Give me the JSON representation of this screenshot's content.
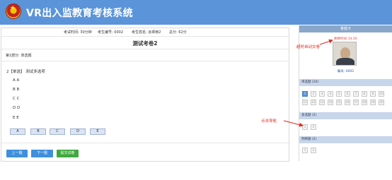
{
  "header": {
    "title": "VR出入监教育考核系统"
  },
  "info": {
    "exam_time": "考试时间: 30分钟",
    "examinee_no": "考生编号: 0002",
    "examinee_name": "考生姓名: 谷翠雨2",
    "score": "总分: 62分"
  },
  "exam": {
    "title": "测试考卷2",
    "part": "第1部分: 单选题",
    "question": "2【单选】 测试多选项",
    "options": [
      "A A",
      "B B",
      "C C",
      "D D",
      "E E"
    ],
    "answer_buttons": [
      "A",
      "B",
      "C",
      "D",
      "E"
    ],
    "prev": "上一题",
    "next": "下一题",
    "submit": "提交试卷"
  },
  "sidebar": {
    "card_title": "答题卡",
    "countdown": "剩余时间 34:26",
    "student_no": "编号: 0002",
    "single": {
      "label": "单选题 (20)",
      "numbers": [
        "1",
        "2",
        "3",
        "4",
        "5",
        "6",
        "7",
        "8",
        "9",
        "10",
        "11",
        "12",
        "13",
        "14",
        "15",
        "16",
        "17",
        "18",
        "19",
        "20"
      ]
    },
    "multi": {
      "label": "多选题 (2)",
      "numbers": [
        "1",
        "2"
      ]
    },
    "judge": {
      "label": "判断题 (2)",
      "numbers": [
        "1",
        "2"
      ]
    }
  },
  "annotations": {
    "auto_submit": "超时自动交卷",
    "click_nav": "点击导航"
  },
  "colors": {
    "header": "#5b94d8",
    "accent": "#5b94d8",
    "submit": "#3ea93e",
    "annotation": "#e0281e"
  }
}
